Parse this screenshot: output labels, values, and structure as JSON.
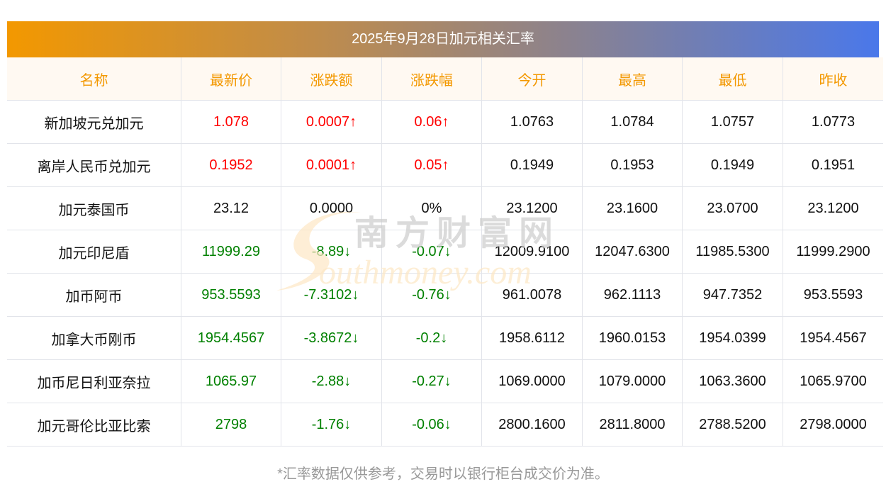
{
  "title": "2025年9月28日加元相关汇率",
  "headers": [
    "名称",
    "最新价",
    "涨跌额",
    "涨跌幅",
    "今开",
    "最高",
    "最低",
    "昨收"
  ],
  "rows": [
    {
      "name": "新加坡元兑加元",
      "latest": "1.078",
      "change": "0.0007↑",
      "pct": "0.06↑",
      "open": "1.0763",
      "high": "1.0784",
      "low": "1.0757",
      "prev": "1.0773",
      "trend": "up"
    },
    {
      "name": "离岸人民币兑加元",
      "latest": "0.1952",
      "change": "0.0001↑",
      "pct": "0.05↑",
      "open": "0.1949",
      "high": "0.1953",
      "low": "0.1949",
      "prev": "0.1951",
      "trend": "up"
    },
    {
      "name": "加元泰国币",
      "latest": "23.12",
      "change": "0.0000",
      "pct": "0%",
      "open": "23.1200",
      "high": "23.1600",
      "low": "23.0700",
      "prev": "23.1200",
      "trend": "flat"
    },
    {
      "name": "加元印尼盾",
      "latest": "11999.29",
      "change": "-8.89↓",
      "pct": "-0.07↓",
      "open": "12009.9100",
      "high": "12047.6300",
      "low": "11985.5300",
      "prev": "11999.2900",
      "trend": "down"
    },
    {
      "name": "加币阿币",
      "latest": "953.5593",
      "change": "-7.3102↓",
      "pct": "-0.76↓",
      "open": "961.0078",
      "high": "962.1113",
      "low": "947.7352",
      "prev": "953.5593",
      "trend": "down"
    },
    {
      "name": "加拿大币刚币",
      "latest": "1954.4567",
      "change": "-3.8672↓",
      "pct": "-0.2↓",
      "open": "1958.6112",
      "high": "1960.0153",
      "low": "1954.0399",
      "prev": "1954.4567",
      "trend": "down"
    },
    {
      "name": "加币尼日利亚奈拉",
      "latest": "1065.97",
      "change": "-2.88↓",
      "pct": "-0.27↓",
      "open": "1069.0000",
      "high": "1079.0000",
      "low": "1063.3600",
      "prev": "1065.9700",
      "trend": "down"
    },
    {
      "name": "加元哥伦比亚比索",
      "latest": "2798",
      "change": "-1.76↓",
      "pct": "-0.06↓",
      "open": "2800.1600",
      "high": "2811.8000",
      "low": "2788.5200",
      "prev": "2798.0000",
      "trend": "down"
    }
  ],
  "footnote": "*汇率数据仅供参考，交易时以银行柜台成交价为准。",
  "watermark": {
    "cn": "南方财富网",
    "en": "outhmoney.com"
  },
  "colors": {
    "up": "#ff0000",
    "down": "#008000",
    "header_text": "#f39800"
  }
}
